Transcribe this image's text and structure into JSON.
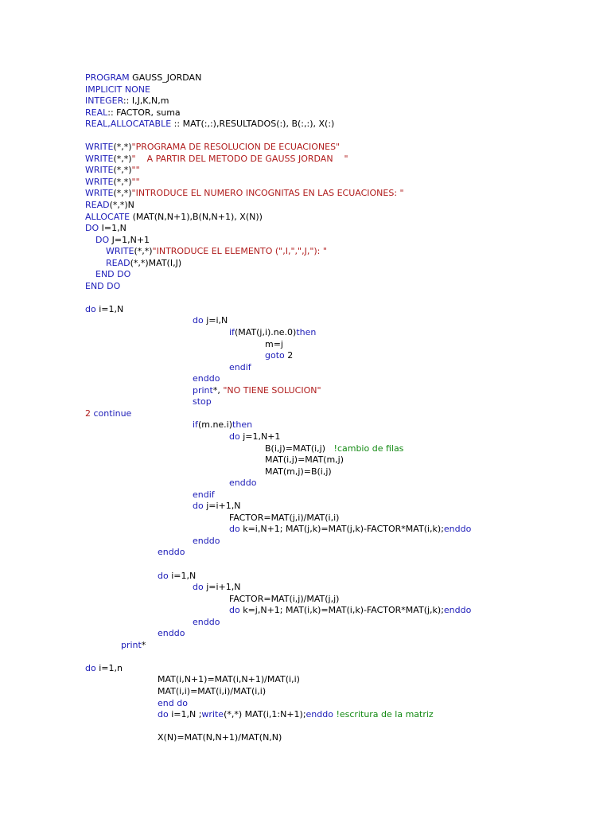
{
  "document": {
    "language": "Fortran",
    "lines": [
      {
        "indent": 0,
        "segments": [
          {
            "t": "PROGRAM",
            "c": "kw"
          },
          {
            "t": " GAUSS_JORDAN",
            "c": ""
          }
        ]
      },
      {
        "indent": 0,
        "segments": [
          {
            "t": "IMPLICIT NONE",
            "c": "kw"
          }
        ]
      },
      {
        "indent": 0,
        "segments": [
          {
            "t": "INTEGER",
            "c": "kw"
          },
          {
            "t": ":: I,J,K,N,m",
            "c": ""
          }
        ]
      },
      {
        "indent": 0,
        "segments": [
          {
            "t": "REAL",
            "c": "kw"
          },
          {
            "t": ":: FACTOR, suma",
            "c": ""
          }
        ]
      },
      {
        "indent": 0,
        "segments": [
          {
            "t": "REAL,ALLOCATABLE",
            "c": "kw"
          },
          {
            "t": " :: MAT(:,:),RESULTADOS(:), B(:,:), X(:)",
            "c": ""
          }
        ]
      },
      {
        "blank": true
      },
      {
        "indent": 0,
        "segments": [
          {
            "t": "WRITE",
            "c": "kw"
          },
          {
            "t": "(*,*)",
            "c": ""
          },
          {
            "t": "\"PROGRAMA DE RESOLUCION DE ECUACIONES\"",
            "c": "str"
          }
        ]
      },
      {
        "indent": 0,
        "segments": [
          {
            "t": "WRITE",
            "c": "kw"
          },
          {
            "t": "(*,*)",
            "c": ""
          },
          {
            "t": "\"    A PARTIR DEL METODO DE GAUSS JORDAN    \"",
            "c": "str"
          }
        ]
      },
      {
        "indent": 0,
        "segments": [
          {
            "t": "WRITE",
            "c": "kw"
          },
          {
            "t": "(*,*)",
            "c": ""
          },
          {
            "t": "\"\"",
            "c": "str"
          }
        ]
      },
      {
        "indent": 0,
        "segments": [
          {
            "t": "WRITE",
            "c": "kw"
          },
          {
            "t": "(*,*)",
            "c": ""
          },
          {
            "t": "\"\"",
            "c": "str"
          }
        ]
      },
      {
        "indent": 0,
        "segments": [
          {
            "t": "WRITE",
            "c": "kw"
          },
          {
            "t": "(*,*)",
            "c": ""
          },
          {
            "t": "\"INTRODUCE EL NUMERO INCOGNITAS EN LAS ECUACIONES: \"",
            "c": "str"
          }
        ]
      },
      {
        "indent": 0,
        "segments": [
          {
            "t": "READ",
            "c": "kw"
          },
          {
            "t": "(*,*)N",
            "c": ""
          }
        ]
      },
      {
        "indent": 0,
        "segments": [
          {
            "t": "ALLOCATE",
            "c": "kw"
          },
          {
            "t": " (MAT(N,N+1),B(N,N+1), X(N))",
            "c": ""
          }
        ]
      },
      {
        "indent": 0,
        "segments": [
          {
            "t": "DO",
            "c": "kw"
          },
          {
            "t": " I=1,N",
            "c": ""
          }
        ]
      },
      {
        "indent": 13,
        "segments": [
          {
            "t": "DO",
            "c": "kw"
          },
          {
            "t": " J=1,N+1",
            "c": ""
          }
        ]
      },
      {
        "indent": 26,
        "segments": [
          {
            "t": "WRITE",
            "c": "kw"
          },
          {
            "t": "(*,*)",
            "c": ""
          },
          {
            "t": "\"INTRODUCE EL ELEMENTO (\",I,\",\",J,\"): \"",
            "c": "str"
          }
        ]
      },
      {
        "indent": 26,
        "segments": [
          {
            "t": "READ",
            "c": "kw"
          },
          {
            "t": "(*,*)MAT(I,J)",
            "c": ""
          }
        ]
      },
      {
        "indent": 13,
        "segments": [
          {
            "t": "END DO",
            "c": "kw"
          }
        ]
      },
      {
        "indent": 0,
        "segments": [
          {
            "t": "END DO",
            "c": "kw"
          }
        ]
      },
      {
        "blank": true
      },
      {
        "indent": 0,
        "segments": [
          {
            "t": "do",
            "c": "kw"
          },
          {
            "t": " i=1,N",
            "c": ""
          }
        ]
      },
      {
        "indent": 135,
        "segments": [
          {
            "t": "do",
            "c": "kw"
          },
          {
            "t": " j=i,N",
            "c": ""
          }
        ]
      },
      {
        "indent": 181,
        "segments": [
          {
            "t": "if",
            "c": "kw"
          },
          {
            "t": "(MAT(j,i).ne.0)",
            "c": ""
          },
          {
            "t": "then",
            "c": "kw"
          }
        ]
      },
      {
        "indent": 226,
        "segments": [
          {
            "t": "m=j",
            "c": ""
          }
        ]
      },
      {
        "indent": 226,
        "segments": [
          {
            "t": "goto",
            "c": "kw"
          },
          {
            "t": " 2",
            "c": ""
          }
        ]
      },
      {
        "indent": 181,
        "segments": [
          {
            "t": "endif",
            "c": "kw"
          }
        ]
      },
      {
        "indent": 135,
        "segments": [
          {
            "t": "enddo",
            "c": "kw"
          }
        ]
      },
      {
        "indent": 135,
        "segments": [
          {
            "t": "print",
            "c": "kw"
          },
          {
            "t": "*, ",
            "c": ""
          },
          {
            "t": "\"NO TIENE SOLUCION\"",
            "c": "str"
          }
        ]
      },
      {
        "indent": 135,
        "segments": [
          {
            "t": "stop",
            "c": "kw"
          }
        ]
      },
      {
        "indent": 0,
        "segments": [
          {
            "t": "2",
            "c": "str"
          },
          {
            "t": " continue",
            "c": "kw"
          }
        ]
      },
      {
        "indent": 135,
        "segments": [
          {
            "t": "if",
            "c": "kw"
          },
          {
            "t": "(m.ne.i)",
            "c": ""
          },
          {
            "t": "then",
            "c": "kw"
          }
        ]
      },
      {
        "indent": 181,
        "segments": [
          {
            "t": "do",
            "c": "kw"
          },
          {
            "t": " j=1,N+1",
            "c": ""
          }
        ]
      },
      {
        "indent": 226,
        "segments": [
          {
            "t": "B(i,j)=MAT(i,j)   ",
            "c": ""
          },
          {
            "t": "!cambio de filas",
            "c": "cm"
          }
        ]
      },
      {
        "indent": 226,
        "segments": [
          {
            "t": "MAT(i,j)=MAT(m,j)",
            "c": ""
          }
        ]
      },
      {
        "indent": 226,
        "segments": [
          {
            "t": "MAT(m,j)=B(i,j)",
            "c": ""
          }
        ]
      },
      {
        "indent": 181,
        "segments": [
          {
            "t": "enddo",
            "c": "kw"
          }
        ]
      },
      {
        "indent": 135,
        "segments": [
          {
            "t": "endif",
            "c": "kw"
          }
        ]
      },
      {
        "indent": 135,
        "segments": [
          {
            "t": "do",
            "c": "kw"
          },
          {
            "t": " j=i+1,N",
            "c": ""
          }
        ]
      },
      {
        "indent": 181,
        "segments": [
          {
            "t": "FACTOR=MAT(j,i)/MAT(i,i)",
            "c": ""
          }
        ]
      },
      {
        "indent": 181,
        "segments": [
          {
            "t": "do",
            "c": "kw"
          },
          {
            "t": " k=i,N+1; MAT(j,k)=MAT(j,k)-FACTOR*MAT(i,k);",
            "c": ""
          },
          {
            "t": "enddo",
            "c": "kw"
          }
        ]
      },
      {
        "indent": 135,
        "segments": [
          {
            "t": "enddo",
            "c": "kw"
          }
        ]
      },
      {
        "indent": 91,
        "segments": [
          {
            "t": "enddo",
            "c": "kw"
          }
        ]
      },
      {
        "blank": true
      },
      {
        "indent": 91,
        "segments": [
          {
            "t": "do",
            "c": "kw"
          },
          {
            "t": " i=1,N",
            "c": ""
          }
        ]
      },
      {
        "indent": 135,
        "segments": [
          {
            "t": "do",
            "c": "kw"
          },
          {
            "t": " j=i+1,N",
            "c": ""
          }
        ]
      },
      {
        "indent": 181,
        "segments": [
          {
            "t": "FACTOR=MAT(i,j)/MAT(j,j)",
            "c": ""
          }
        ]
      },
      {
        "indent": 181,
        "segments": [
          {
            "t": "do",
            "c": "kw"
          },
          {
            "t": " k=j,N+1; MAT(i,k)=MAT(i,k)-FACTOR*MAT(j,k);",
            "c": ""
          },
          {
            "t": "enddo",
            "c": "kw"
          }
        ]
      },
      {
        "indent": 135,
        "segments": [
          {
            "t": "enddo",
            "c": "kw"
          }
        ]
      },
      {
        "indent": 91,
        "segments": [
          {
            "t": "enddo",
            "c": "kw"
          }
        ]
      },
      {
        "indent": 45,
        "segments": [
          {
            "t": "print",
            "c": "kw"
          },
          {
            "t": "*",
            "c": ""
          }
        ]
      },
      {
        "blank": true
      },
      {
        "indent": 0,
        "segments": [
          {
            "t": "do",
            "c": "kw"
          },
          {
            "t": " i=1,n",
            "c": ""
          }
        ]
      },
      {
        "indent": 91,
        "segments": [
          {
            "t": "MAT(i,N+1)=MAT(i,N+1)/MAT(i,i)",
            "c": ""
          }
        ]
      },
      {
        "indent": 91,
        "segments": [
          {
            "t": "MAT(i,i)=MAT(i,i)/MAT(i,i)",
            "c": ""
          }
        ]
      },
      {
        "indent": 91,
        "segments": [
          {
            "t": "end do",
            "c": "kw"
          }
        ]
      },
      {
        "indent": 91,
        "segments": [
          {
            "t": "do",
            "c": "kw"
          },
          {
            "t": " i=1,N ;",
            "c": ""
          },
          {
            "t": "write",
            "c": "kw"
          },
          {
            "t": "(*,*) MAT(i,1:N+1);",
            "c": ""
          },
          {
            "t": "enddo",
            "c": "kw"
          },
          {
            "t": " ",
            "c": ""
          },
          {
            "t": "!escritura de la matriz",
            "c": "cm"
          }
        ]
      },
      {
        "blank": true
      },
      {
        "indent": 91,
        "segments": [
          {
            "t": "X(N)=MAT(N,N+1)/MAT(N,N)",
            "c": ""
          }
        ]
      }
    ]
  },
  "colors": {
    "keyword": "#1d1db8",
    "string": "#b01c1c",
    "comment": "#138a13",
    "text": "#000000",
    "background": "#ffffff"
  }
}
